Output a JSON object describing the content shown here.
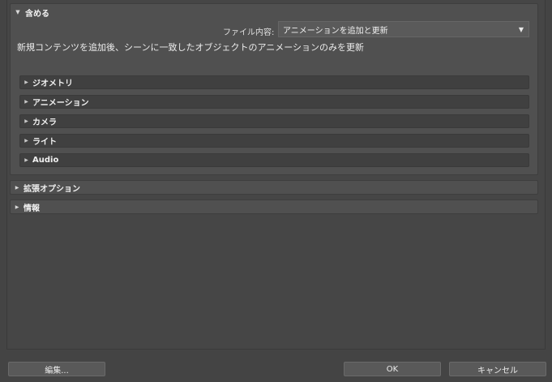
{
  "include": {
    "title": "含める",
    "file_content_label": "ファイル内容:",
    "file_content_value": "アニメーションを追加と更新",
    "description": "新規コンテンツを追加後、シーンに一致したオブジェクトのアニメーションのみを更新",
    "sections": [
      {
        "label": "ジオメトリ"
      },
      {
        "label": "アニメーション"
      },
      {
        "label": "カメラ"
      },
      {
        "label": "ライト"
      },
      {
        "label": "Audio"
      }
    ]
  },
  "advanced_options": {
    "title": "拡張オプション"
  },
  "info": {
    "title": "情報"
  },
  "buttons": {
    "edit": "編集...",
    "ok": "OK",
    "cancel": "キャンセル"
  }
}
